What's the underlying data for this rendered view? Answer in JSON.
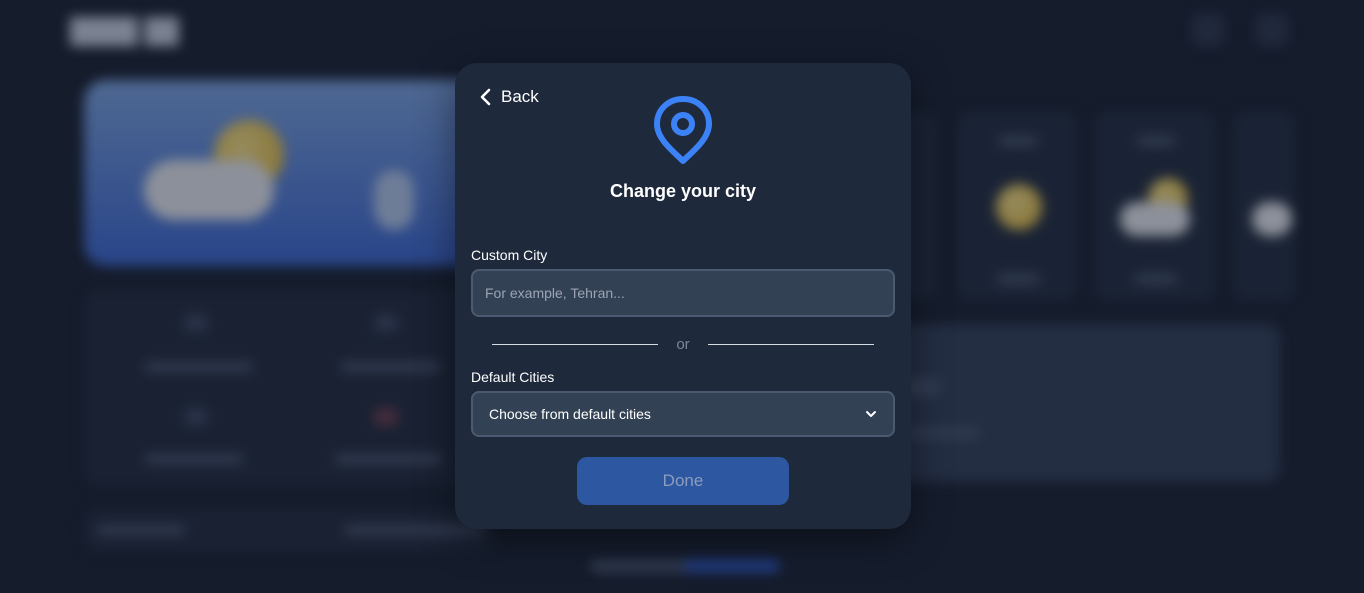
{
  "modal": {
    "back_label": "Back",
    "title": "Change your city",
    "custom_city_label": "Custom City",
    "custom_city_placeholder": "For example, Tehran...",
    "custom_city_value": "",
    "divider_text": "or",
    "default_cities_label": "Default Cities",
    "default_cities_selected": "Choose from default cities",
    "done_label": "Done"
  },
  "icons": {
    "back": "chevron-left-icon",
    "location": "map-pin-icon",
    "select_arrow": "chevron-down-icon"
  },
  "colors": {
    "accent": "#3b82f6",
    "modal_bg": "#1e293b",
    "input_bg": "#334155",
    "done_button_bg": "#2d57a0",
    "page_bg": "#151c2c"
  }
}
